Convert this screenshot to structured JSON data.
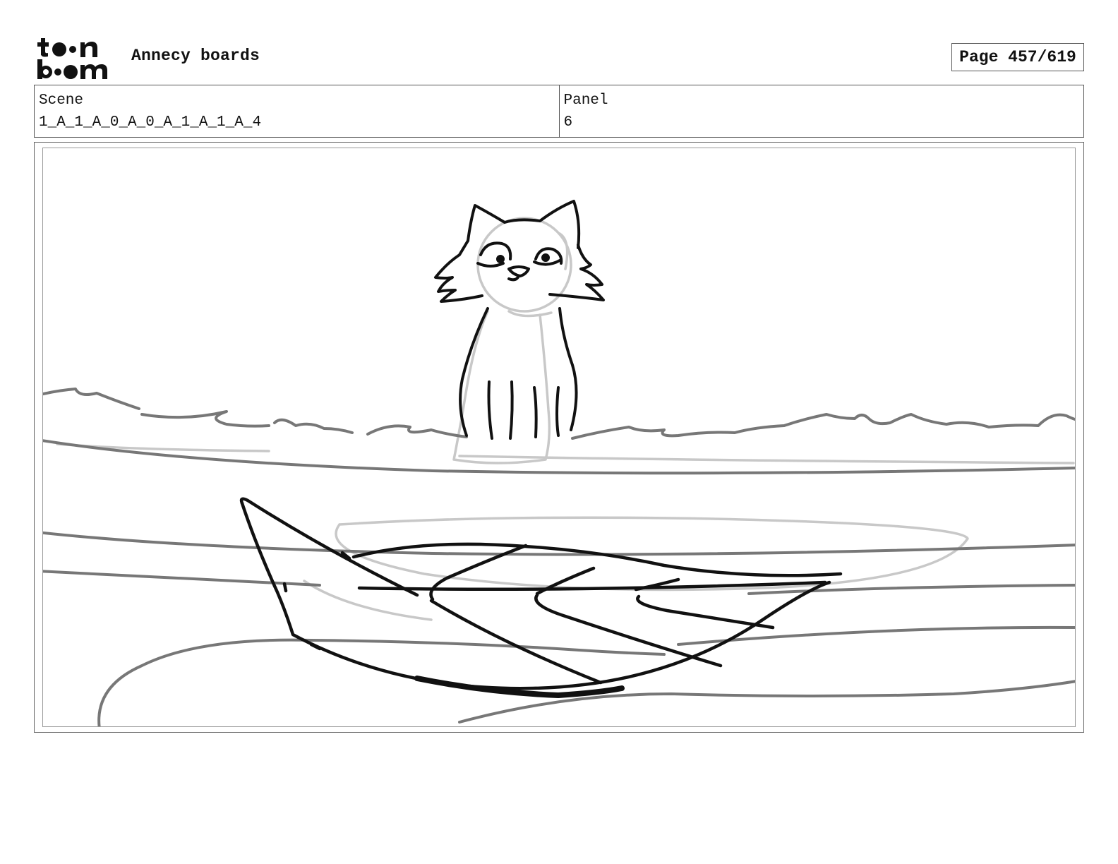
{
  "header": {
    "logo": {
      "text": "toon boom",
      "icon": "toon-boom-logo"
    },
    "project_title": "Annecy boards",
    "page_label": "Page 457/619"
  },
  "info": {
    "scene_label": "Scene",
    "scene_value": "1_A_1_A_0_A_0_A_1_A_1_A_4",
    "panel_label": "Panel",
    "panel_value": "6"
  },
  "panel_image": {
    "subject": "cat-sketch",
    "secondary": "rowboat-sketch",
    "palette": {
      "ink": "#111111",
      "mid_gray": "#777777",
      "light_gray": "#c8c8c8"
    }
  }
}
